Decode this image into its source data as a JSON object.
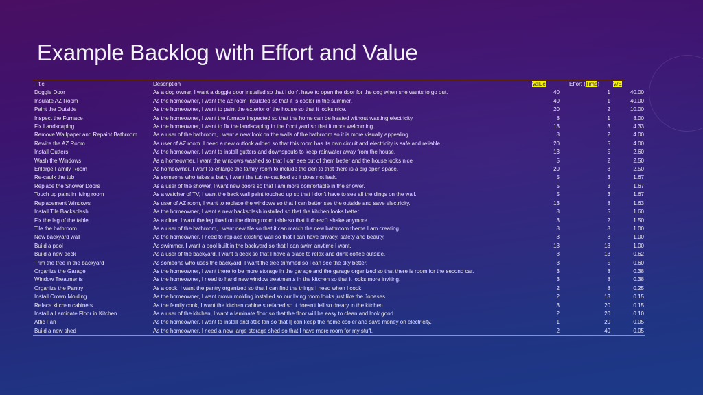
{
  "slide": {
    "title": "Example Backlog with Effort and Value"
  },
  "table": {
    "headers": {
      "title": "Title",
      "description": "Description",
      "value": "Value",
      "effort_prefix": "Effort (",
      "effort_highlight": "Time",
      "effort_suffix": ")",
      "ve": "V/E"
    },
    "highlight_color": "#f5f500",
    "rows": [
      {
        "title": "Doggie Door",
        "description": "As a dog owner, I want a doggie door installed so that I don't have to open the door for the dog when she wants to go out.",
        "value": "40",
        "effort": "1",
        "ve": "40.00"
      },
      {
        "title": "Insulate AZ Room",
        "description": "As the homeowner, I want the az room insulated so that it is cooler in the summer.",
        "value": "40",
        "effort": "1",
        "ve": "40.00"
      },
      {
        "title": "Paint the Outside",
        "description": "As the homeowner, I want to paint the exterior of the house so that it looks nice.",
        "value": "20",
        "effort": "2",
        "ve": "10.00"
      },
      {
        "title": "Inspect the Furnace",
        "description": "As the homeowner, I want the furnace inspected so that the home can be heated without wasting electricity",
        "value": "8",
        "effort": "1",
        "ve": "8.00"
      },
      {
        "title": "Fix Landscaping",
        "description": "As the homeowner, I want to fix the landscaping in the front yard so that it more welcoming.",
        "value": "13",
        "effort": "3",
        "ve": "4.33"
      },
      {
        "title": "Remove Wallpaper and Repaint Bathroom",
        "description": "As a user of the bathroom, I want a new look on the walls of the bathroom so it is more visually appealing.",
        "value": "8",
        "effort": "2",
        "ve": "4.00"
      },
      {
        "title": "Rewire the AZ Room",
        "description": "As user of AZ room. I need a new outlook added so that this room has its own circuit and electricity is safe and reliable.",
        "value": "20",
        "effort": "5",
        "ve": "4.00"
      },
      {
        "title": "Install Gutters",
        "description": "As the homeowner, I want to install gutters and downspouts to keep rainwater away from the house.",
        "value": "13",
        "effort": "5",
        "ve": "2.60"
      },
      {
        "title": "Wash the Windows",
        "description": "As a homeowner, I want the windows washed so that I can see out of them better and the house looks nice",
        "value": "5",
        "effort": "2",
        "ve": "2.50"
      },
      {
        "title": "Enlarge Family Room",
        "description": "As homeowner, I want to enlarge the family room to include the den to that there is a big open space.",
        "value": "20",
        "effort": "8",
        "ve": "2.50"
      },
      {
        "title": "Re-caulk the tub",
        "description": "As someone who takes a bath, I want the tub re-caulked so it does not leak.",
        "value": "5",
        "effort": "3",
        "ve": "1.67"
      },
      {
        "title": "Replace the Shower Doors",
        "description": "As a user of the shower, I want new doors so that I am more comfortable in the shower.",
        "value": "5",
        "effort": "3",
        "ve": "1.67"
      },
      {
        "title": "Touch up paint in living room",
        "description": "As a watcher of TV, I want the back wall paint touched up so that I don't have to see all the dings on the wall.",
        "value": "5",
        "effort": "3",
        "ve": "1.67"
      },
      {
        "title": "Replacement Windows",
        "description": "As user of AZ room, I want to replace the windows so that I can better see the outside and save electricity.",
        "value": "13",
        "effort": "8",
        "ve": "1.63"
      },
      {
        "title": "Install Tile Backsplash",
        "description": "As the homeowner, I want a new backsplash installed so that the kitchen looks better",
        "value": "8",
        "effort": "5",
        "ve": "1.60"
      },
      {
        "title": "Fix the leg of the table",
        "description": "As a diner, I want the leg fixed on the dining room table so that it doesn't shake anymore.",
        "value": "3",
        "effort": "2",
        "ve": "1.50"
      },
      {
        "title": "Tile the bathroom",
        "description": "As a user of the bathroom, I want new tile so that it can match the new bathroom theme I am creating.",
        "value": "8",
        "effort": "8",
        "ve": "1.00"
      },
      {
        "title": "New backyard wall",
        "description": "As the homeowner, I need to replace existing wall so that I can have privacy, safety and beauty.",
        "value": "8",
        "effort": "8",
        "ve": "1.00"
      },
      {
        "title": "Build a pool",
        "description": "As swimmer, I want a pool built in the backyard so that I can swim anytime I want.",
        "value": "13",
        "effort": "13",
        "ve": "1.00"
      },
      {
        "title": "Build a new deck",
        "description": "As a user of the backyard, I want a deck so that I have a place to relax and drink coffee outside.",
        "value": "8",
        "effort": "13",
        "ve": "0.62"
      },
      {
        "title": "Trim the tree in the backyard",
        "description": "As someone who uses the backyard, I want the tree trimmed so I can see the sky better.",
        "value": "3",
        "effort": "5",
        "ve": "0.60"
      },
      {
        "title": "Organize the Garage",
        "description": "As the homeowner, I want there to be more storage in the garage and the garage organized so that there is room for the second car.",
        "value": "3",
        "effort": "8",
        "ve": "0.38"
      },
      {
        "title": "Window Treatments",
        "description": "As the homeowner, I need to hand new window treatments in the kitchen so that it looks more inviting.",
        "value": "3",
        "effort": "8",
        "ve": "0.38"
      },
      {
        "title": "Organize the Pantry",
        "description": "As a cook, I want the pantry organized so that I can find the things I need when I cook.",
        "value": "2",
        "effort": "8",
        "ve": "0.25"
      },
      {
        "title": "Install Crown Molding",
        "description": "As the homeowner, I want crown molding installed so our living room looks just like the Joneses",
        "value": "2",
        "effort": "13",
        "ve": "0.15"
      },
      {
        "title": "Reface kitchen cabinets",
        "description": "As the family cook, I want the kitchen cabinets refaced so it doesn't fell so dreary in the kitchen.",
        "value": "3",
        "effort": "20",
        "ve": "0.15"
      },
      {
        "title": "Install a Laminate Floor in Kitchen",
        "description": "As a user of the kitchen, I want a laminate floor so that the floor will be easy to clean and look good.",
        "value": "2",
        "effort": "20",
        "ve": "0.10"
      },
      {
        "title": "Attic Fan",
        "description": "As the homeowner, I want to install and attic fan so that I[ can keep the home cooler and save money on electricity.",
        "value": "1",
        "effort": "20",
        "ve": "0.05"
      },
      {
        "title": "Build a new shed",
        "description": "As the homeowner, I need a new large storage shed so that I have more room for my stuff.",
        "value": "2",
        "effort": "40",
        "ve": "0.05"
      }
    ]
  }
}
